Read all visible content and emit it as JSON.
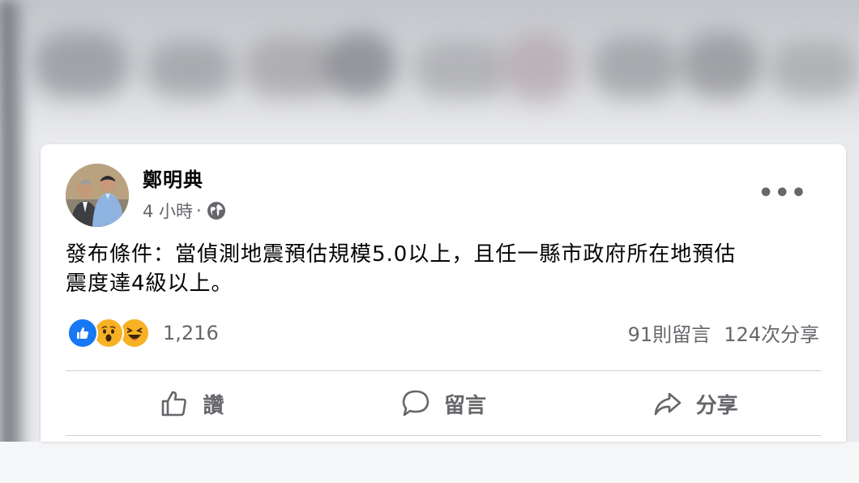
{
  "post": {
    "author": "鄭明典",
    "time": "4 小時",
    "separator": "·",
    "text": "發布條件：當偵測地震預估規模5.0以上，且任一縣市政府所在地預估\n震度達4級以上。",
    "reactions": {
      "types": [
        "like-icon",
        "wow-icon",
        "haha-icon"
      ],
      "count": "1,216"
    },
    "comments_count": "91則留言",
    "shares_count": "124次分享"
  },
  "actions": {
    "like_label": "讚",
    "comment_label": "留言",
    "share_label": "分享"
  },
  "colors": {
    "like_blue": "#1877f2",
    "emoji_yellow": "#f7b125",
    "muted_text": "#65676b"
  }
}
